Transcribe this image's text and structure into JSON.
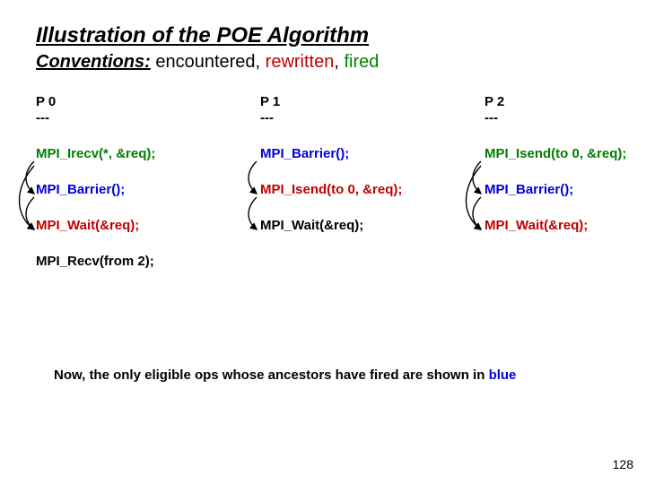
{
  "title": "Illustration of the POE Algorithm",
  "subtitle": {
    "label": "Conventions:",
    "encountered": "encountered",
    "rewritten": "rewritten",
    "fired": "fired"
  },
  "columns": [
    {
      "header": "P 0\n---",
      "rows": [
        {
          "text": "MPI_Irecv(*, &req);",
          "cls": "fired"
        },
        {
          "text": "MPI_Barrier();",
          "cls": "blue"
        },
        {
          "text": "MPI_Wait(&req);",
          "cls": "rew"
        },
        {
          "text": "MPI_Recv(from 2);",
          "cls": "enc"
        }
      ]
    },
    {
      "header": "P 1\n---",
      "rows": [
        {
          "text": "MPI_Barrier();",
          "cls": "blue"
        },
        {
          "text": "MPI_Isend(to 0, &req);",
          "cls": "rew"
        },
        {
          "text": "MPI_Wait(&req);",
          "cls": "enc"
        }
      ]
    },
    {
      "header": "P 2\n---",
      "rows": [
        {
          "text": "MPI_Isend(to 0, &req);",
          "cls": "fired"
        },
        {
          "text": "MPI_Barrier();",
          "cls": "blue"
        },
        {
          "text": "MPI_Wait(&req);",
          "cls": "rew"
        }
      ]
    }
  ],
  "footnote_pre": "Now, the only eligible ops whose ancestors have fired are shown in ",
  "footnote_blue": "blue",
  "pagenum": "128"
}
